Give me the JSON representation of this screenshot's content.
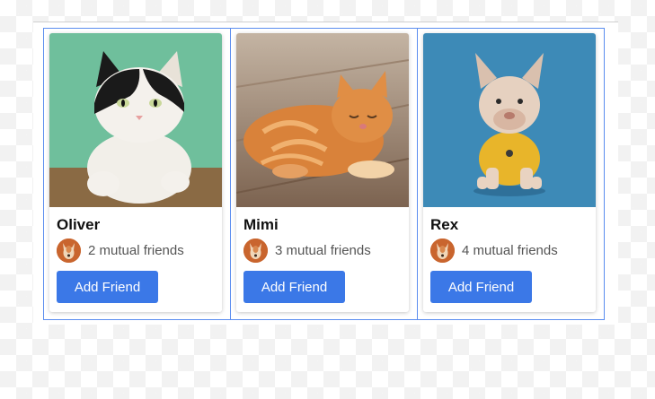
{
  "friends": [
    {
      "name": "Oliver",
      "mutual": "2 mutual friends",
      "button": "Add Friend",
      "photo": "cat-photo",
      "bg": "#6fbf9c"
    },
    {
      "name": "Mimi",
      "mutual": "3 mutual friends",
      "button": "Add Friend",
      "photo": "cat-photo",
      "bg": "#a58a72"
    },
    {
      "name": "Rex",
      "mutual": "4 mutual friends",
      "button": "Add Friend",
      "photo": "dog-photo",
      "bg": "#3d8ab7"
    }
  ],
  "colors": {
    "button": "#3b78e7",
    "selection_border": "#5b8def",
    "avatar": "#c9652e"
  }
}
